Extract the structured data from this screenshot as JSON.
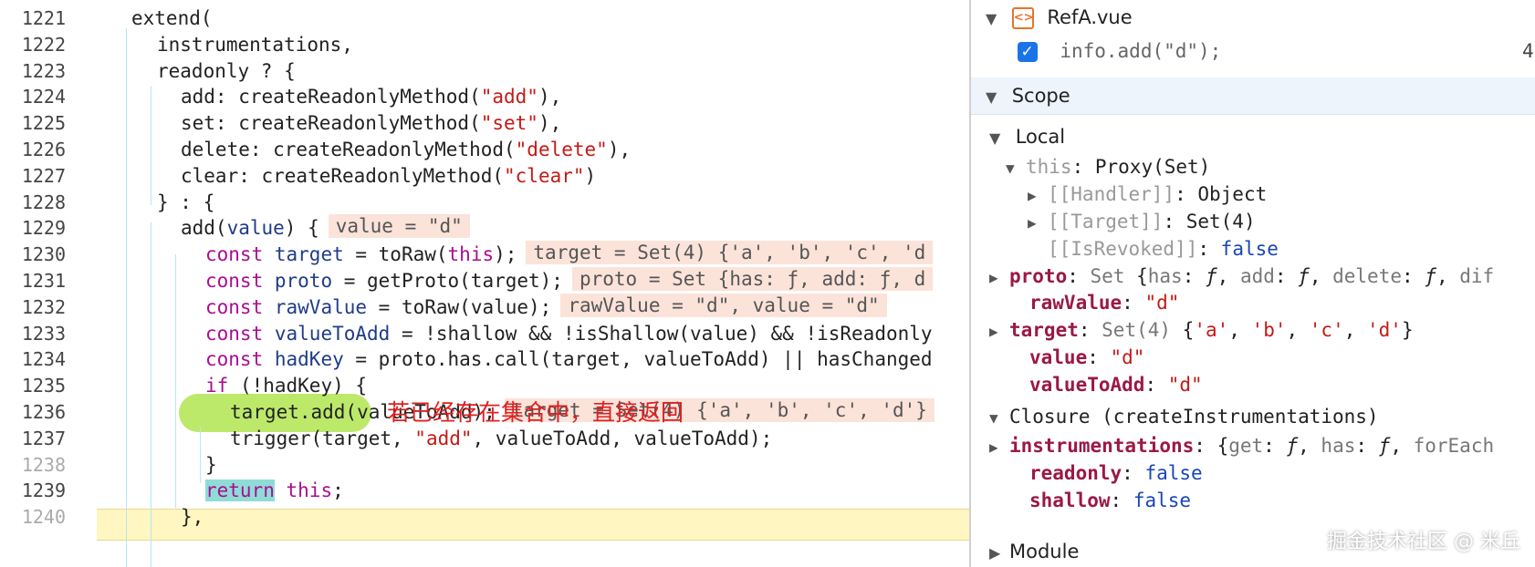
{
  "editor": {
    "lines": [
      {
        "n": "1221"
      },
      {
        "n": "1222"
      },
      {
        "n": "1223"
      },
      {
        "n": "1224"
      },
      {
        "n": "1225"
      },
      {
        "n": "1226"
      },
      {
        "n": "1227"
      },
      {
        "n": "1228"
      },
      {
        "n": "1229"
      },
      {
        "n": "1230"
      },
      {
        "n": "1231"
      },
      {
        "n": "1232"
      },
      {
        "n": "1233"
      },
      {
        "n": "1234"
      },
      {
        "n": "1235"
      },
      {
        "n": "1236"
      },
      {
        "n": "1237"
      },
      {
        "n": "1238"
      },
      {
        "n": "1239"
      },
      {
        "n": "1240"
      }
    ],
    "tokens": {
      "l1221": "extend(",
      "l1222": "instrumentations,",
      "l1223": "readonly ? {",
      "l1224_a": "add: createReadonlyMethod(",
      "l1224_s": "\"add\"",
      "l1224_b": "),",
      "l1225_a": "set: createReadonlyMethod(",
      "l1225_s": "\"set\"",
      "l1225_b": "),",
      "l1226_a": "delete: createReadonlyMethod(",
      "l1226_s": "\"delete\"",
      "l1226_b": "),",
      "l1227_a": "clear: createReadonlyMethod(",
      "l1227_s": "\"clear\"",
      "l1227_b": ")",
      "l1228": "} : {",
      "l1229_a": "add(",
      "l1229_v": "value",
      "l1229_b": ") {",
      "l1230_k": "const",
      "l1230_v": "target",
      "l1230_a": " = toRaw(",
      "l1230_t": "this",
      "l1230_b": ");",
      "l1231_k": "const",
      "l1231_v": "proto",
      "l1231_a": " = getProto(target);",
      "l1232_k": "const",
      "l1232_v": "rawValue",
      "l1232_a": " = toRaw(value);",
      "l1233_k": "const",
      "l1233_v": "valueToAdd",
      "l1233_a": " = !shallow && !isShallow(value) && !isReadonly",
      "l1234_k": "const",
      "l1234_v": "hadKey",
      "l1234_a": " = proto.has.call(target, valueToAdd) || hasChanged",
      "l1235_k": "if",
      "l1235_a": " (!hadKey) {",
      "l1236_a": "target.add(valueToAdd);",
      "l1237_a": "trigger(target, ",
      "l1237_s": "\"add\"",
      "l1237_b": ", valueToAdd, valueToAdd);",
      "l1238": "}",
      "l1239_k": "return",
      "l1239_t": "this",
      "l1239_b": ";",
      "l1240": "},"
    },
    "inline_values": {
      "l1229": "value = \"d\"",
      "l1230": "target = Set(4) {'a', 'b', 'c', 'd",
      "l1231": "proto = Set {has: ƒ, add: ƒ, d",
      "l1232": "rawValue = \"d\", value = \"d\"",
      "l1236": "target = Set(4) {'a', 'b', 'c', 'd'}"
    },
    "annotation": "若已经存在集合中，直接返回",
    "breakpoint_color": "#bde96b",
    "current_line": "1239"
  },
  "panel": {
    "breakpoint_file": "RefA.vue",
    "breakpoint_code": "info.add(\"d\");",
    "breakpoint_line": "4",
    "scope_title": "Scope",
    "local_title": "Local",
    "this_key": "this",
    "this_val": "Proxy(Set)",
    "handler_key": "[[Handler]]",
    "handler_val": "Object",
    "target_int_key": "[[Target]]",
    "target_int_val": "Set(4)",
    "revoked_key": "[[IsRevoked]]",
    "revoked_val": "false",
    "proto_key": "proto",
    "proto_type": "Set",
    "proto_fields": [
      {
        "k": "has",
        "v": "ƒ"
      },
      {
        "k": "add",
        "v": "ƒ"
      },
      {
        "k": "delete",
        "v": "ƒ"
      }
    ],
    "proto_tail": "dif",
    "rawValue_key": "rawValue",
    "rawValue_val": "\"d\"",
    "target_key": "target",
    "target_type": "Set(4)",
    "target_items": [
      "'a'",
      "'b'",
      "'c'",
      "'d'"
    ],
    "value_key": "value",
    "value_val": "\"d\"",
    "valueToAdd_key": "valueToAdd",
    "valueToAdd_val": "\"d\"",
    "closure_title": "Closure (createInstrumentations)",
    "instr_key": "instrumentations",
    "instr_fields": [
      {
        "k": "get",
        "v": "ƒ"
      },
      {
        "k": "has",
        "v": "ƒ"
      }
    ],
    "instr_tail": "forEach",
    "readonly_key": "readonly",
    "readonly_val": "false",
    "shallow_key": "shallow",
    "shallow_val": "false",
    "module_title": "Module",
    "watermark": "掘金技术社区 @ 米丘"
  }
}
